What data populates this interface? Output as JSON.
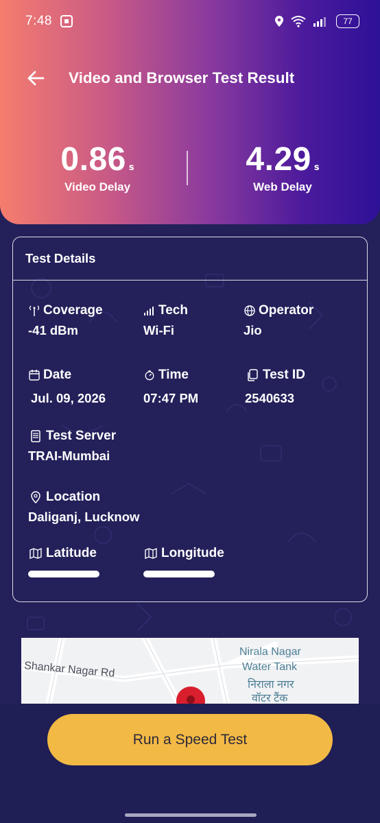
{
  "status_bar": {
    "time": "7:48",
    "battery": "77"
  },
  "header": {
    "title": "Video and Browser Test Result"
  },
  "metrics": [
    {
      "value": "0.86",
      "unit": "s",
      "label": "Video Delay"
    },
    {
      "value": "4.29",
      "unit": "s",
      "label": "Web Delay"
    }
  ],
  "details": {
    "title": "Test Details",
    "coverage": {
      "label": "Coverage",
      "value": "-41 dBm"
    },
    "tech": {
      "label": "Tech",
      "value": "Wi-Fi"
    },
    "operator": {
      "label": "Operator",
      "value": "Jio"
    },
    "date": {
      "label": "Date",
      "value": "Jul. 09, 2026"
    },
    "time": {
      "label": "Time",
      "value": "07:47 PM"
    },
    "test_id": {
      "label": "Test ID",
      "value": "2540633"
    },
    "server": {
      "label": "Test Server",
      "value": "TRAI-Mumbai"
    },
    "location": {
      "label": "Location",
      "value": "Daliganj, Lucknow"
    },
    "latitude": {
      "label": "Latitude"
    },
    "longitude": {
      "label": "Longitude"
    }
  },
  "map": {
    "road": "Shankar Nagar Rd",
    "poi_line1": "Nirala Nagar",
    "poi_line2": "Water Tank",
    "poi_hindi1": "निराला नगर",
    "poi_hindi2": "वॉटर टैंक"
  },
  "actions": {
    "run_test": "Run a Speed Test"
  },
  "colors": {
    "button": "#f2b945",
    "background": "#23205a"
  }
}
